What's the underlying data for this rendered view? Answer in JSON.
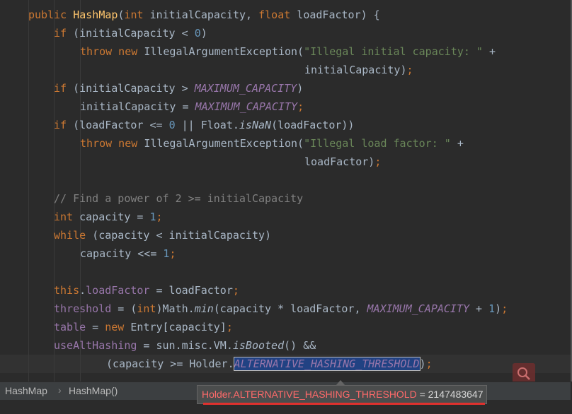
{
  "editor": {
    "lines": [
      {
        "tokens": [
          [
            "kw",
            "public "
          ],
          [
            "fn",
            "HashMap"
          ],
          [
            "",
            "("
          ],
          [
            "kw",
            "int "
          ],
          [
            "",
            "initialCapacity, "
          ],
          [
            "kw",
            "float "
          ],
          [
            "",
            "loadFactor) {"
          ]
        ]
      },
      {
        "tokens": [
          [
            "kw",
            "if "
          ],
          [
            "",
            "(initialCapacity < "
          ],
          [
            "num",
            "0"
          ],
          [
            "",
            ")"
          ]
        ]
      },
      {
        "tokens": [
          [
            "kw",
            "throw new "
          ],
          [
            "",
            "IllegalArgumentException("
          ],
          [
            "str",
            "\"Illegal initial capacity: \""
          ],
          [
            "",
            " +"
          ]
        ]
      },
      {
        "tokens": [
          [
            "",
            "initialCapacity)"
          ],
          [
            "kw",
            ";"
          ]
        ]
      },
      {
        "tokens": [
          [
            "kw",
            "if "
          ],
          [
            "",
            "(initialCapacity > "
          ],
          [
            "cn",
            "MAXIMUM_CAPACITY"
          ],
          [
            "",
            ")"
          ]
        ]
      },
      {
        "tokens": [
          [
            "",
            "initialCapacity = "
          ],
          [
            "cn",
            "MAXIMUM_CAPACITY"
          ],
          [
            "kw",
            ";"
          ]
        ]
      },
      {
        "tokens": [
          [
            "kw",
            "if "
          ],
          [
            "",
            "(loadFactor <= "
          ],
          [
            "num",
            "0"
          ],
          [
            "",
            " || Float."
          ],
          [
            "st",
            "isNaN"
          ],
          [
            "",
            "(loadFactor))"
          ]
        ]
      },
      {
        "tokens": [
          [
            "kw",
            "throw new "
          ],
          [
            "",
            "IllegalArgumentException("
          ],
          [
            "str",
            "\"Illegal load factor: \""
          ],
          [
            "",
            " +"
          ]
        ]
      },
      {
        "tokens": [
          [
            "",
            "loadFactor)"
          ],
          [
            "kw",
            ";"
          ]
        ]
      },
      {
        "tokens": []
      },
      {
        "tokens": [
          [
            "cm",
            "// Find a power of 2 >= initialCapacity"
          ]
        ]
      },
      {
        "tokens": [
          [
            "kw",
            "int "
          ],
          [
            "",
            "capacity = "
          ],
          [
            "num",
            "1"
          ],
          [
            "kw",
            ";"
          ]
        ]
      },
      {
        "tokens": [
          [
            "kw",
            "while "
          ],
          [
            "",
            "(capacity < initialCapacity)"
          ]
        ]
      },
      {
        "tokens": [
          [
            "",
            "capacity <<= "
          ],
          [
            "num",
            "1"
          ],
          [
            "kw",
            ";"
          ]
        ]
      },
      {
        "tokens": []
      },
      {
        "tokens": [
          [
            "kw",
            "this"
          ],
          [
            "",
            "."
          ],
          [
            "fld",
            "loadFactor"
          ],
          [
            "",
            " = loadFactor"
          ],
          [
            "kw",
            ";"
          ]
        ]
      },
      {
        "tokens": [
          [
            "fld",
            "threshold"
          ],
          [
            "",
            " = ("
          ],
          [
            "kw",
            "int"
          ],
          [
            "",
            ")Math."
          ],
          [
            "st",
            "min"
          ],
          [
            "",
            "(capacity * loadFactor, "
          ],
          [
            "cn",
            "MAXIMUM_CAPACITY"
          ],
          [
            "",
            " + "
          ],
          [
            "num",
            "1"
          ],
          [
            "",
            ")"
          ],
          [
            "kw",
            ";"
          ]
        ]
      },
      {
        "tokens": [
          [
            "fld",
            "table"
          ],
          [
            "",
            " = "
          ],
          [
            "kw",
            "new "
          ],
          [
            "",
            "Entry[capacity]"
          ],
          [
            "kw",
            ";"
          ]
        ]
      },
      {
        "tokens": [
          [
            "fld",
            "useAltHashing"
          ],
          [
            "",
            " = sun.misc.VM."
          ],
          [
            "st",
            "isBooted"
          ],
          [
            "",
            "() &&"
          ]
        ]
      },
      {
        "tokens": [
          [
            "",
            "(capacity >= Holder."
          ],
          [
            "sel",
            "ALTERNATIVE_HASHING_THRESHOLD"
          ],
          [
            "",
            ")"
          ],
          [
            "kw",
            ";"
          ]
        ]
      }
    ]
  },
  "breadcrumb": {
    "items": [
      "HashMap",
      "HashMap()"
    ]
  },
  "tooltip": {
    "name": "Holder.ALTERNATIVE_HASHING_THRESHOLD",
    "rest": " = 2147483647"
  },
  "icons": {
    "search": "search-icon"
  },
  "colors": {
    "background": "#2b2b2b",
    "keyword": "#cc7832",
    "constant": "#9876aa",
    "string": "#6a8759",
    "number": "#6897bb",
    "comment": "#808080",
    "tooltip_underline": "#e0312e"
  }
}
